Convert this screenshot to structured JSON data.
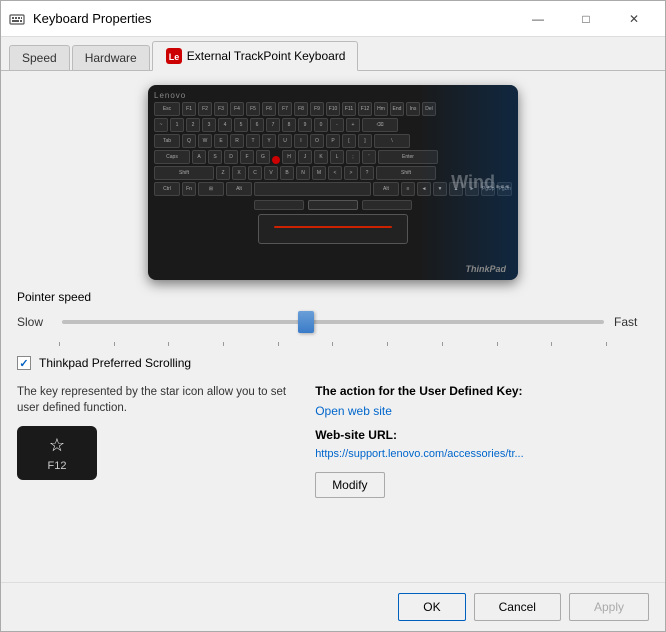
{
  "window": {
    "title": "Keyboard Properties",
    "icon": "keyboard-icon"
  },
  "tabs": [
    {
      "id": "speed",
      "label": "Speed",
      "active": false
    },
    {
      "id": "hardware",
      "label": "Hardware",
      "active": false
    },
    {
      "id": "external",
      "label": "External TrackPoint Keyboard",
      "active": true,
      "has_icon": true
    }
  ],
  "keyboard": {
    "brand": "Lenovo",
    "thinkpad_brand": "ThinkPad",
    "windows_hint": "Wind..."
  },
  "pointer": {
    "label": "Pointer speed",
    "slow_label": "Slow",
    "fast_label": "Fast",
    "value": 45
  },
  "scrolling": {
    "label": "Thinkpad Preferred Scrolling",
    "checked": true
  },
  "left_panel": {
    "info_text": "The key represented by the star icon allow you to set user defined function."
  },
  "right_panel": {
    "action_label": "The action for the User Defined Key:",
    "action_value": "Open web site",
    "url_label": "Web-site URL:",
    "url_value": "https://support.lenovo.com/accessories/tr...",
    "modify_label": "Modify"
  },
  "footer": {
    "ok_label": "OK",
    "cancel_label": "Cancel",
    "apply_label": "Apply"
  }
}
